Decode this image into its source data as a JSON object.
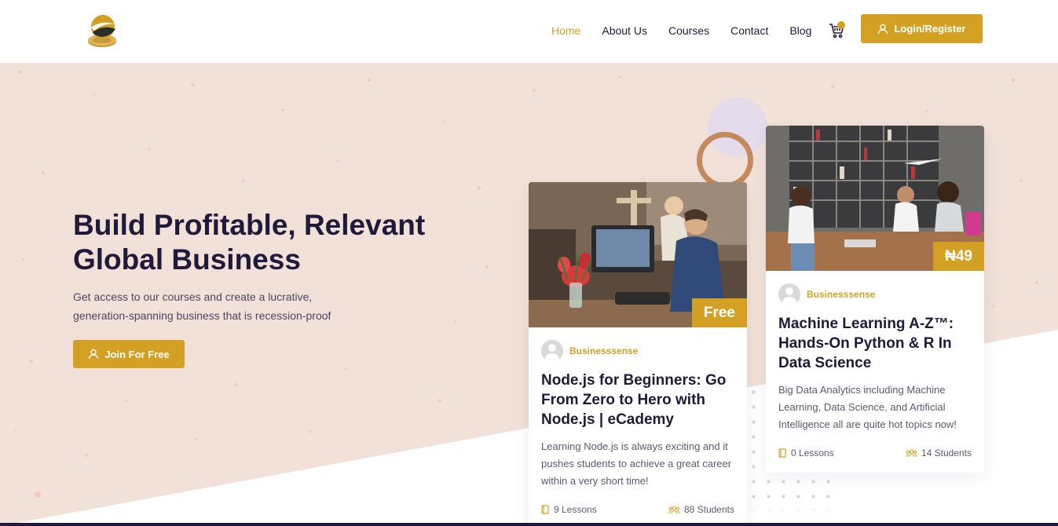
{
  "header": {
    "logo_icon": "coin-logo-icon",
    "nav": [
      {
        "label": "Home",
        "active": true
      },
      {
        "label": "About Us",
        "active": false
      },
      {
        "label": "Courses",
        "active": false
      },
      {
        "label": "Contact",
        "active": false
      },
      {
        "label": "Blog",
        "active": false
      }
    ],
    "cart_icon": "cart-icon",
    "login_label": "Login/Register"
  },
  "hero": {
    "title": "Build Profitable, Relevant Global Business",
    "subtitle": "Get access to our courses and create a lucrative, generation-spanning business that is recession-proof",
    "cta_label": "Join For Free"
  },
  "courses": [
    {
      "price_badge": "Free",
      "author": "Businesssense",
      "title": "Node.js for Beginners: Go From Zero to Hero with Node.js | eCademy",
      "description": "Learning Node.js is always exciting and it pushes students to achieve a great career within a very short time!",
      "lessons": "9 Lessons",
      "students": "88 Students"
    },
    {
      "price_badge": "₦49",
      "author": "Businesssense",
      "title": "Machine Learning A-Z™: Hands-On Python & R In Data Science",
      "description": "Big Data Analytics including Machine Learning, Data Science, and Artificial Intelligence all are quite hot topics now!",
      "lessons": "0 Lessons",
      "students": "14 Students"
    }
  ],
  "colors": {
    "accent": "#d4a024",
    "heading": "#1f1a3a",
    "hero_bg": "#f1e1d8"
  }
}
